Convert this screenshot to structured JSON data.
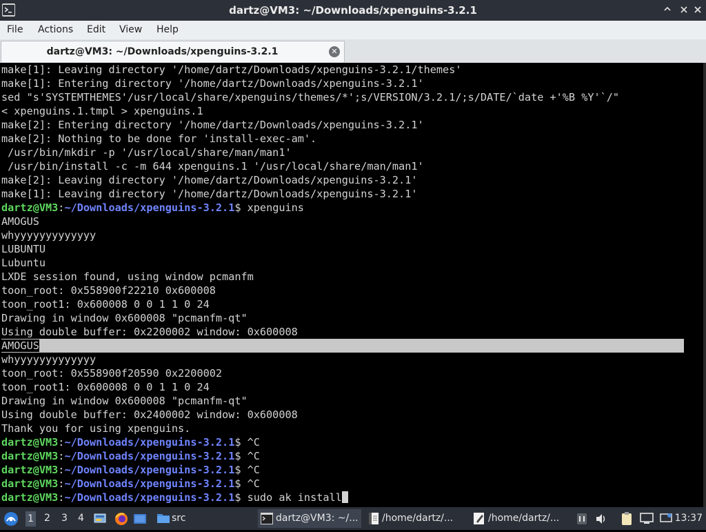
{
  "window": {
    "title": "dartz@VM3: ~/Downloads/xpenguins-3.2.1",
    "icons": {
      "app": "terminal-icon",
      "shade": "shade-icon",
      "minimize": "minimize-icon",
      "maximize": "maximize-icon",
      "close": "close-icon"
    }
  },
  "menu": [
    "File",
    "Actions",
    "Edit",
    "View",
    "Help"
  ],
  "tab": {
    "label": "dartz@VM3: ~/Downloads/xpenguins-3.2.1",
    "close_icon": "tab-close-icon"
  },
  "prompt": {
    "user": "dartz@VM3",
    "colon": ":",
    "path": "~/Downloads/xpenguins-3.2.1",
    "dollar": "$ "
  },
  "terminal_lines": [
    {
      "type": "out",
      "text": "make[1]: Leaving directory '/home/dartz/Downloads/xpenguins-3.2.1/themes'"
    },
    {
      "type": "out",
      "text": "make[1]: Entering directory '/home/dartz/Downloads/xpenguins-3.2.1'"
    },
    {
      "type": "out",
      "text": "sed \"s'SYSTEMTHEMES'/usr/local/share/xpenguins/themes/*';s/VERSION/3.2.1/;s/DATE/`date +'%B %Y'`/\""
    },
    {
      "type": "out",
      "text": "< xpenguins.1.tmpl > xpenguins.1"
    },
    {
      "type": "out",
      "text": "make[2]: Entering directory '/home/dartz/Downloads/xpenguins-3.2.1'"
    },
    {
      "type": "out",
      "text": "make[2]: Nothing to be done for 'install-exec-am'."
    },
    {
      "type": "out",
      "text": " /usr/bin/mkdir -p '/usr/local/share/man/man1'"
    },
    {
      "type": "out",
      "text": " /usr/bin/install -c -m 644 xpenguins.1 '/usr/local/share/man/man1'"
    },
    {
      "type": "out",
      "text": "make[2]: Leaving directory '/home/dartz/Downloads/xpenguins-3.2.1'"
    },
    {
      "type": "out",
      "text": "make[1]: Leaving directory '/home/dartz/Downloads/xpenguins-3.2.1'"
    },
    {
      "type": "cmd",
      "text": "xpenguins"
    },
    {
      "type": "out",
      "text": "AMOGUS"
    },
    {
      "type": "out",
      "text": "whyyyyyyyyyyyyy"
    },
    {
      "type": "out",
      "text": "LUBUNTU"
    },
    {
      "type": "out",
      "text": "Lubuntu"
    },
    {
      "type": "out",
      "text": "LXDE session found, using window pcmanfm"
    },
    {
      "type": "out",
      "text": "toon_root: 0x558900f22210 0x600008"
    },
    {
      "type": "out",
      "text": "toon_root1: 0x600008 0 0 1 1 0 24"
    },
    {
      "type": "out",
      "text": "Drawing in window 0x600008 \"pcmanfm-qt\""
    },
    {
      "type": "out",
      "text": "Using double buffer: 0x2200002 window: 0x600008"
    },
    {
      "type": "hl",
      "text": "AMOGUS"
    },
    {
      "type": "out",
      "text": "whyyyyyyyyyyyyy"
    },
    {
      "type": "out",
      "text": "toon_root: 0x558900f20590 0x2200002"
    },
    {
      "type": "out",
      "text": "toon_root1: 0x600008 0 0 1 1 0 24"
    },
    {
      "type": "out",
      "text": "Drawing in window 0x600008 \"pcmanfm-qt\""
    },
    {
      "type": "out",
      "text": "Using double buffer: 0x2400002 window: 0x600008"
    },
    {
      "type": "out",
      "text": "Thank you for using xpenguins."
    },
    {
      "type": "cmd",
      "text": "^C"
    },
    {
      "type": "cmd",
      "text": "^C"
    },
    {
      "type": "cmd",
      "text": "^C"
    },
    {
      "type": "cmd",
      "text": "^C"
    },
    {
      "type": "cmd_cursor",
      "text": "sudo ak install"
    }
  ],
  "taskbar": {
    "start_icon": "lubuntu-start-icon",
    "workspaces": [
      "1",
      "2",
      "3",
      "4"
    ],
    "launchers": [
      "desktop-icon",
      "firefox-icon",
      "show-desktop-icon"
    ],
    "folder_task": {
      "icon": "folder-icon",
      "label": "src"
    },
    "tasks": [
      {
        "icon": "terminal-icon",
        "label": "dartz@VM3: ~/..."
      },
      {
        "icon": "text-file-icon",
        "label": "/home/dartz/..."
      },
      {
        "icon": "edit-file-icon",
        "label": "/home/dartz/..."
      }
    ],
    "tray_icons": [
      "media-player-icon",
      "volume-icon",
      "clipboard-icon",
      "monitor-icon",
      "network-icon"
    ],
    "clock": "13:37",
    "colors": {
      "panel": "#2b3038",
      "prompt_user": "#5fd75f",
      "prompt_path": "#6f84ff"
    }
  }
}
